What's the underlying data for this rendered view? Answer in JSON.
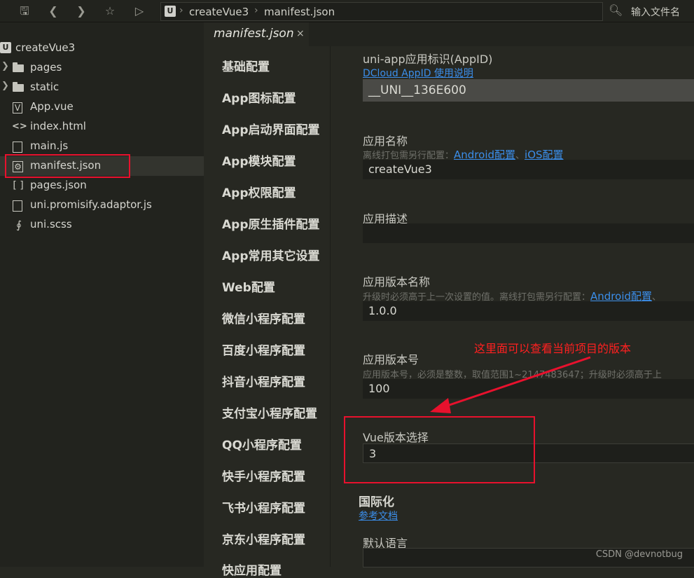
{
  "toolbar": {
    "breadcrumb": [
      "createVue3",
      "manifest.json"
    ],
    "logo_letter": "U",
    "search_label": "输入文件名"
  },
  "sidebar": {
    "project_name": "createVue3",
    "items": [
      {
        "label": "pages",
        "icon": "folder-icon"
      },
      {
        "label": "static",
        "icon": "folder-icon"
      },
      {
        "label": "App.vue",
        "icon": "vue-file-icon"
      },
      {
        "label": "index.html",
        "icon": "html-file-icon"
      },
      {
        "label": "main.js",
        "icon": "file-icon"
      },
      {
        "label": "manifest.json",
        "icon": "settings-file-icon"
      },
      {
        "label": "pages.json",
        "icon": "json-file-icon"
      },
      {
        "label": "uni.promisify.adaptor.js",
        "icon": "file-icon"
      },
      {
        "label": "uni.scss",
        "icon": "scss-file-icon"
      }
    ]
  },
  "tab": {
    "label": "manifest.json",
    "close": "×"
  },
  "settings_nav": [
    "基础配置",
    "App图标配置",
    "App启动界面配置",
    "App模块配置",
    "App权限配置",
    "App原生插件配置",
    "App常用其它设置",
    "Web配置",
    "微信小程序配置",
    "百度小程序配置",
    "抖音小程序配置",
    "支付宝小程序配置",
    "QQ小程序配置",
    "快手小程序配置",
    "飞书小程序配置",
    "京东小程序配置",
    "快应用配置"
  ],
  "form": {
    "appid": {
      "label": "uni-app应用标识(AppID)",
      "link": "DCloud AppID 使用说明",
      "value": "__UNI__136E600"
    },
    "app_name": {
      "label": "应用名称",
      "hint_prefix": "离线打包需另行配置：",
      "link_android": "Android配置",
      "sep": "、",
      "link_ios": "iOS配置",
      "value": "createVue3"
    },
    "app_desc": {
      "label": "应用描述",
      "value": ""
    },
    "version_name": {
      "label": "应用版本名称",
      "hint_prefix": "升级时必须高于上一次设置的值。离线打包需另行配置：",
      "link_android": "Android配置",
      "sep": "、",
      "value": "1.0.0"
    },
    "version_code": {
      "label": "应用版本号",
      "hint": "应用版本号，必须是整数，取值范围1~2147483647；升级时必须高于上",
      "value": "100"
    },
    "vue_version": {
      "label": "Vue版本选择",
      "value": "3"
    },
    "i18n": {
      "heading": "国际化",
      "link": "参考文档",
      "default_lang_label": "默认语言"
    }
  },
  "annotation": {
    "text": "这里面可以查看当前项目的版本"
  },
  "watermark": "CSDN @devnotbug",
  "colors": {
    "accent_link": "#3b8eea",
    "annotation_red": "#e8112d"
  }
}
